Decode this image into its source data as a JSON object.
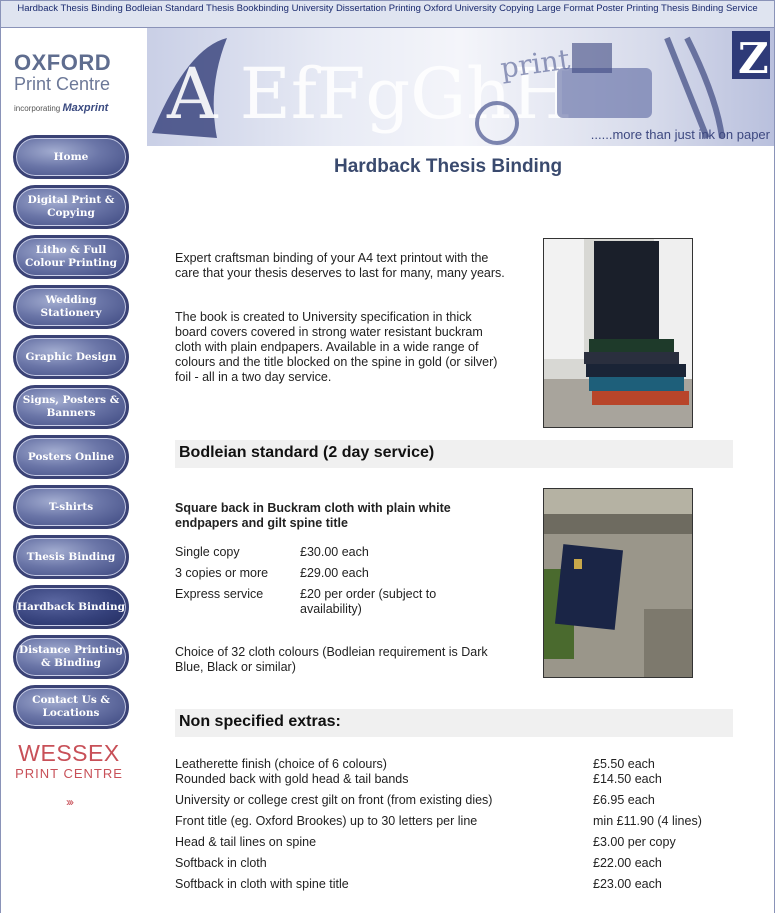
{
  "top_banner_text": "Hardback Thesis Binding Bodleian Standard Thesis Bookbinding University Dissertation Printing Oxford University Copying Large Format Poster Printing Thesis Binding Service",
  "logo": {
    "line1": "OXFORD",
    "line2": "Print Centre",
    "line3_prefix": "incorporating",
    "line3_brand": "Maxprint"
  },
  "nav": [
    {
      "label": "Home"
    },
    {
      "label": "Digital Print & Copying"
    },
    {
      "label": "Litho & Full Colour Printing"
    },
    {
      "label": "Wedding Stationery"
    },
    {
      "label": "Graphic Design"
    },
    {
      "label": "Signs, Posters & Banners"
    },
    {
      "label": "Posters Online"
    },
    {
      "label": "T-shirts"
    },
    {
      "label": "Thesis Binding"
    },
    {
      "label": "Hardback Binding"
    },
    {
      "label": "Distance Printing & Binding"
    },
    {
      "label": "Contact Us & Locations"
    }
  ],
  "wessex": {
    "line1": "WESSEX",
    "line2": "PRINT CENTRE",
    "arrows": "›››"
  },
  "banner": {
    "tagline": "......more than just ink on paper",
    "letters": "A EfFgGhH",
    "print_word": "print",
    "corner_letter": "Z"
  },
  "page_title": "Hardback Thesis Binding",
  "intro": {
    "p1": "Expert craftsman binding of your A4 text printout with the care that your thesis deserves to last for many, many years.",
    "p2": "The book is created to University specification in thick board covers covered in strong water resistant buckram cloth with plain endpapers. Available in a wide range of colours and the title blocked on the spine in gold (or silver) foil - all in a two day service."
  },
  "bodleian": {
    "heading": "Bodleian standard (2 day service)",
    "subheading": "Square back in Buckram cloth with plain white endpapers and gilt spine title",
    "prices": [
      {
        "label": "Single copy",
        "price": "£30.00 each"
      },
      {
        "label": "3 copies or more",
        "price": "£29.00 each"
      },
      {
        "label": "Express service",
        "price": "£20 per order (subject to availability)"
      }
    ],
    "note": "Choice of 32 cloth colours (Bodleian requirement is Dark Blue, Black or similar)"
  },
  "extras": {
    "heading": "Non specified extras:",
    "items": [
      {
        "label": "Leatherette finish (choice of 6 colours)",
        "price": "£5.50 each"
      },
      {
        "label": "Rounded back with gold head & tail bands",
        "price": "£14.50 each"
      },
      {
        "label": "University or college crest gilt on front (from existing dies)",
        "price": "£6.95 each"
      },
      {
        "label": "Front title (eg. Oxford Brookes) up to 30 letters per line",
        "price": "min £11.90 (4 lines)"
      },
      {
        "label": "Head & tail lines on spine",
        "price": "£3.00 per copy"
      },
      {
        "label": "Softback in cloth",
        "price": "£22.00 each"
      },
      {
        "label": "Softback in cloth with spine title",
        "price": "£23.00 each"
      }
    ]
  },
  "colors": {
    "nav_blue": "#3d4880",
    "title_blue": "#3a4a6e",
    "wessex_red": "#c85058"
  }
}
